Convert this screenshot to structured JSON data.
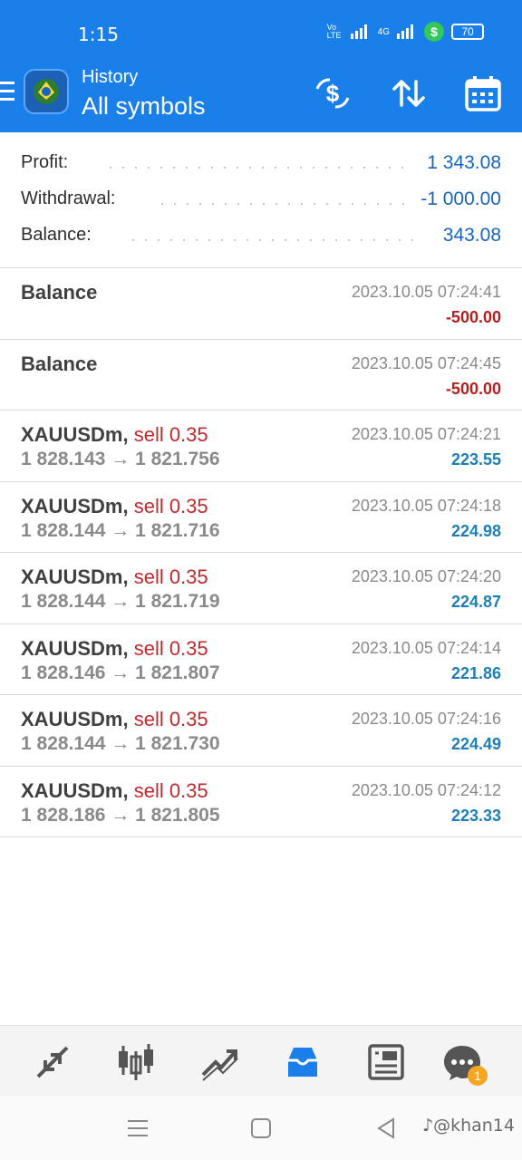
{
  "status_bar": {
    "time": "1:15",
    "network_label_1": "Vo LTE",
    "network_label_2": "4G",
    "battery": "70"
  },
  "app_bar": {
    "subtitle": "History",
    "title": "All symbols",
    "actions": [
      "dollar-swap-icon",
      "sort-icon",
      "calendar-icon"
    ]
  },
  "summary": {
    "profit_label": "Profit:",
    "profit_value": "1 343.08",
    "withdrawal_label": "Withdrawal:",
    "withdrawal_value": "-1 000.00",
    "balance_label": "Balance:",
    "balance_value": "343.08"
  },
  "history": [
    {
      "title": "Balance",
      "sell": "",
      "time": "2023.10.05 07:24:41",
      "prices": "",
      "profit": "-500.00",
      "negative": true
    },
    {
      "title": "Balance",
      "sell": "",
      "time": "2023.10.05 07:24:45",
      "prices": "",
      "profit": "-500.00",
      "negative": true
    },
    {
      "title": "XAUUSDm,",
      "sell": "sell 0.35",
      "time": "2023.10.05 07:24:21",
      "prices": "1 828.143 → 1 821.756",
      "profit": "223.55",
      "negative": false
    },
    {
      "title": "XAUUSDm,",
      "sell": "sell 0.35",
      "time": "2023.10.05 07:24:18",
      "prices": "1 828.144 → 1 821.716",
      "profit": "224.98",
      "negative": false
    },
    {
      "title": "XAUUSDm,",
      "sell": "sell 0.35",
      "time": "2023.10.05 07:24:20",
      "prices": "1 828.144 → 1 821.719",
      "profit": "224.87",
      "negative": false
    },
    {
      "title": "XAUUSDm,",
      "sell": "sell 0.35",
      "time": "2023.10.05 07:24:14",
      "prices": "1 828.146 → 1 821.807",
      "profit": "221.86",
      "negative": false
    },
    {
      "title": "XAUUSDm,",
      "sell": "sell 0.35",
      "time": "2023.10.05 07:24:16",
      "prices": "1 828.144 → 1 821.730",
      "profit": "224.49",
      "negative": false
    },
    {
      "title": "XAUUSDm,",
      "sell": "sell 0.35",
      "time": "2023.10.05 07:24:12",
      "prices": "1 828.186 → 1 821.805",
      "profit": "223.33",
      "negative": false
    }
  ],
  "bottom_nav": {
    "items": [
      "quotes-icon",
      "chart-icon",
      "trade-icon",
      "history-icon",
      "news-icon",
      "chat-icon"
    ],
    "active": "history-icon",
    "chat_badge": "1"
  },
  "system_nav": {
    "watermark": "♪@khan14"
  },
  "colors": {
    "accent": "#1a7fe8",
    "positive": "#1e7fb5",
    "negative": "#b3201f",
    "sell": "#c0292d"
  }
}
